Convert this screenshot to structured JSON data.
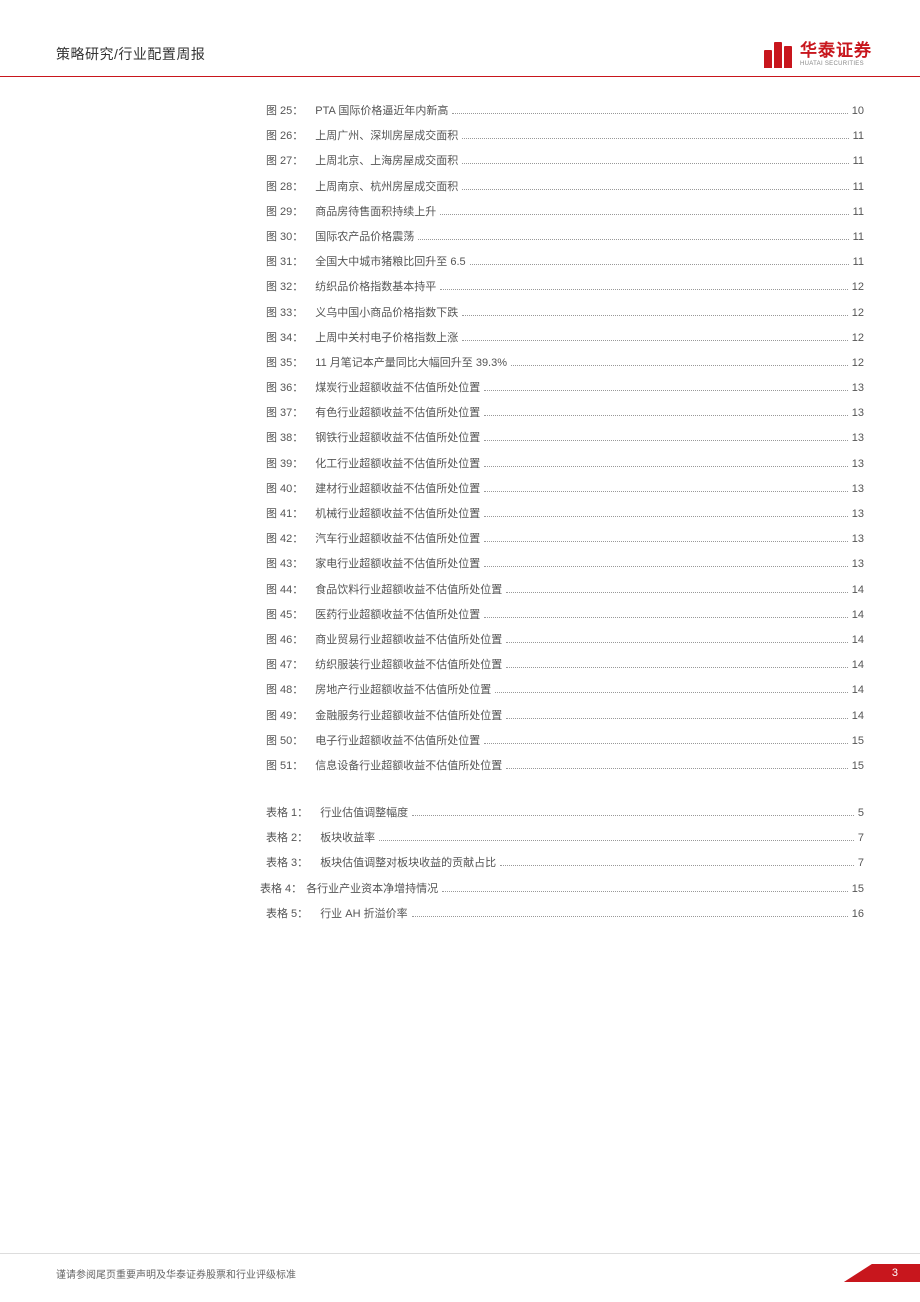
{
  "header": {
    "title": "策略研究/行业配置周报",
    "logo_cn": "华泰证券",
    "logo_en": "HUATAI SECURITIES"
  },
  "figures": [
    {
      "label": "图 25：",
      "title": "PTA 国际价格逼近年内新高",
      "page": "10"
    },
    {
      "label": "图 26：",
      "title": "上周广州、深圳房屋成交面积",
      "page": "11"
    },
    {
      "label": "图 27：",
      "title": "上周北京、上海房屋成交面积",
      "page": "11"
    },
    {
      "label": "图 28：",
      "title": "上周南京、杭州房屋成交面积",
      "page": "11"
    },
    {
      "label": "图 29：",
      "title": "商品房待售面积持续上升",
      "page": "11"
    },
    {
      "label": "图 30：",
      "title": "国际农产品价格震荡",
      "page": "11"
    },
    {
      "label": "图 31：",
      "title": "全国大中城市猪粮比回升至 6.5",
      "page": "11"
    },
    {
      "label": "图 32：",
      "title": "纺织品价格指数基本持平",
      "page": "12"
    },
    {
      "label": "图 33：",
      "title": "义乌中国小商品价格指数下跌",
      "page": "12"
    },
    {
      "label": "图 34：",
      "title": "上周中关村电子价格指数上涨",
      "page": "12"
    },
    {
      "label": "图 35：",
      "title": "11 月笔记本产量同比大幅回升至 39.3%",
      "page": "12"
    },
    {
      "label": "图 36：",
      "title": "煤炭行业超额收益不估值所处位置",
      "page": "13"
    },
    {
      "label": "图 37：",
      "title": "有色行业超额收益不估值所处位置",
      "page": "13"
    },
    {
      "label": "图 38：",
      "title": "钢铁行业超额收益不估值所处位置",
      "page": "13"
    },
    {
      "label": "图 39：",
      "title": "化工行业超额收益不估值所处位置",
      "page": "13"
    },
    {
      "label": "图 40：",
      "title": "建材行业超额收益不估值所处位置",
      "page": "13"
    },
    {
      "label": "图 41：",
      "title": "机械行业超额收益不估值所处位置",
      "page": "13"
    },
    {
      "label": "图 42：",
      "title": "汽车行业超额收益不估值所处位置",
      "page": "13"
    },
    {
      "label": "图 43：",
      "title": "家电行业超额收益不估值所处位置",
      "page": "13"
    },
    {
      "label": "图 44：",
      "title": "食品饮料行业超额收益不估值所处位置",
      "page": "14"
    },
    {
      "label": "图 45：",
      "title": "医药行业超额收益不估值所处位置",
      "page": "14"
    },
    {
      "label": "图 46：",
      "title": "商业贸易行业超额收益不估值所处位置",
      "page": "14"
    },
    {
      "label": "图 47：",
      "title": "纺织服装行业超额收益不估值所处位置",
      "page": "14"
    },
    {
      "label": "图 48：",
      "title": "房地产行业超额收益不估值所处位置",
      "page": "14"
    },
    {
      "label": "图 49：",
      "title": "金融服务行业超额收益不估值所处位置",
      "page": "14"
    },
    {
      "label": "图 50：",
      "title": "电子行业超额收益不估值所处位置",
      "page": "15"
    },
    {
      "label": "图 51：",
      "title": "信息设备行业超额收益不估值所处位置",
      "page": "15"
    }
  ],
  "tables": [
    {
      "label": "表格 1：",
      "title": "行业估值调整幅度",
      "page": "5"
    },
    {
      "label": "表格 2：",
      "title": "板块收益率",
      "page": "7"
    },
    {
      "label": "表格 3：",
      "title": "板块估值调整对板块收益的贡献占比",
      "page": "7"
    },
    {
      "label": "表格 4：",
      "title": "各行业产业资本净增持情况",
      "page": "15"
    },
    {
      "label": "表格 5：",
      "title": "行业 AH 折溢价率",
      "page": "16"
    }
  ],
  "footer": {
    "disclaimer": "谨请参阅尾页重要声明及华泰证券股票和行业评级标准",
    "page": "3"
  }
}
